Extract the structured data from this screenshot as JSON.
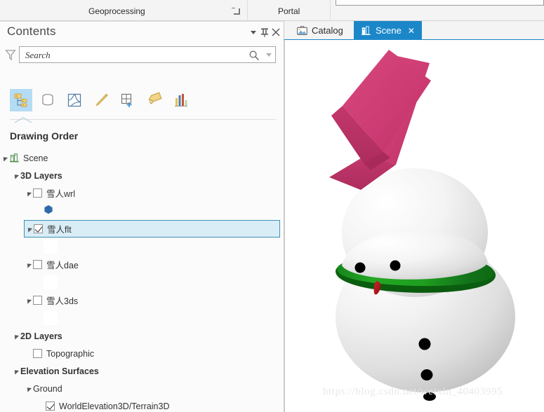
{
  "ribbon": {
    "groups": [
      {
        "label": "Geoprocessing",
        "name": "ribbon-tab-geoprocessing"
      },
      {
        "label": "Portal",
        "name": "ribbon-tab-portal"
      }
    ],
    "launcher_icon": "dialog-launcher-icon"
  },
  "contents": {
    "title": "Contents",
    "header_buttons": [
      {
        "label": "▾",
        "name": "panel-menu-button",
        "icon": "chevron-down-icon"
      },
      {
        "label": "⤓",
        "name": "panel-pin-button",
        "icon": "pin-icon"
      },
      {
        "label": "✕",
        "name": "panel-close-button",
        "icon": "close-icon"
      }
    ],
    "search": {
      "placeholder": "Search",
      "value": "",
      "filter_icon": "filter-funnel-icon",
      "search_icon": "search-icon",
      "dropdown_icon": "chevron-down-icon"
    },
    "toolbar": [
      {
        "name": "list-by-drawing-order-button",
        "icon": "drawing-order-icon",
        "tooltip": "List By Drawing Order",
        "active": true
      },
      {
        "name": "list-by-data-source-button",
        "icon": "database-cylinder-icon",
        "tooltip": "List By Data Source",
        "active": false
      },
      {
        "name": "list-by-selection-button",
        "icon": "selection-polygon-icon",
        "tooltip": "List By Selection",
        "active": false
      },
      {
        "name": "list-by-editing-button",
        "icon": "pencil-icon",
        "tooltip": "List By Editing",
        "active": false
      },
      {
        "name": "list-by-snapping-button",
        "icon": "grid-plus-icon",
        "tooltip": "List By Snapping",
        "active": false
      },
      {
        "name": "list-by-labeling-button",
        "icon": "label-tag-icon",
        "tooltip": "List By Labeling",
        "active": false
      },
      {
        "name": "list-by-charts-button",
        "icon": "bar-chart-icon",
        "tooltip": "List By Charts",
        "active": false
      }
    ],
    "drawing_order_label": "Drawing Order",
    "tree": [
      {
        "label": "Scene",
        "type": "scene",
        "indent": 0,
        "expander": "open",
        "checkbox": "none",
        "icon": "scene-3d-icon",
        "bold": false,
        "selected": false,
        "name": "tree-item-scene"
      },
      {
        "label": "3D Layers",
        "type": "group",
        "indent": 16,
        "expander": "open",
        "checkbox": "none",
        "icon": "",
        "bold": true,
        "selected": false,
        "name": "tree-item-3d-layers"
      },
      {
        "label": "雪人wrl",
        "type": "layer",
        "indent": 34,
        "expander": "open",
        "checkbox": "unchecked",
        "icon": "",
        "bold": false,
        "selected": false,
        "name": "tree-item-snowman-wrl"
      },
      {
        "label": "",
        "type": "swatch-blue",
        "indent": 48,
        "expander": "none",
        "checkbox": "none",
        "icon": "blue-polygon-swatch",
        "bold": false,
        "selected": false,
        "name": "tree-symbol-swatch-wrl"
      },
      {
        "label": "雪人flt",
        "type": "layer",
        "indent": 34,
        "expander": "open",
        "checkbox": "checked",
        "icon": "",
        "bold": false,
        "selected": true,
        "name": "tree-item-snowman-flt"
      },
      {
        "label": "",
        "type": "swatch-blank",
        "indent": 48,
        "expander": "none",
        "checkbox": "none",
        "icon": "blank-swatch",
        "bold": false,
        "selected": false,
        "name": "tree-symbol-swatch-flt"
      },
      {
        "label": "雪人dae",
        "type": "layer",
        "indent": 34,
        "expander": "open",
        "checkbox": "unchecked",
        "icon": "",
        "bold": false,
        "selected": false,
        "name": "tree-item-snowman-dae"
      },
      {
        "label": "",
        "type": "swatch-blank",
        "indent": 48,
        "expander": "none",
        "checkbox": "none",
        "icon": "blank-swatch",
        "bold": false,
        "selected": false,
        "name": "tree-symbol-swatch-dae"
      },
      {
        "label": "雪人3ds",
        "type": "layer",
        "indent": 34,
        "expander": "open",
        "checkbox": "unchecked",
        "icon": "",
        "bold": false,
        "selected": false,
        "name": "tree-item-snowman-3ds"
      },
      {
        "label": "",
        "type": "swatch-blank",
        "indent": 48,
        "expander": "none",
        "checkbox": "none",
        "icon": "blank-swatch",
        "bold": false,
        "selected": false,
        "name": "tree-symbol-swatch-3ds"
      },
      {
        "label": "2D Layers",
        "type": "group",
        "indent": 16,
        "expander": "open",
        "checkbox": "none",
        "icon": "",
        "bold": true,
        "selected": false,
        "name": "tree-item-2d-layers"
      },
      {
        "label": "Topographic",
        "type": "layer",
        "indent": 34,
        "expander": "none",
        "checkbox": "unchecked",
        "icon": "",
        "bold": false,
        "selected": false,
        "name": "tree-item-topographic"
      },
      {
        "label": "Elevation Surfaces",
        "type": "group",
        "indent": 16,
        "expander": "open",
        "checkbox": "none",
        "icon": "",
        "bold": true,
        "selected": false,
        "name": "tree-item-elevation-surfaces"
      },
      {
        "label": "Ground",
        "type": "group",
        "indent": 34,
        "expander": "open",
        "checkbox": "none",
        "icon": "",
        "bold": false,
        "selected": false,
        "name": "tree-item-ground"
      },
      {
        "label": "WorldElevation3D/Terrain3D",
        "type": "layer",
        "indent": 52,
        "expander": "none",
        "checkbox": "checked",
        "icon": "",
        "bold": false,
        "selected": false,
        "name": "tree-item-worldelevation3d-terrain3d"
      }
    ]
  },
  "view": {
    "tabs": [
      {
        "label": "Catalog",
        "name": "tab-catalog",
        "icon": "catalog-icon",
        "active": false,
        "closable": false
      },
      {
        "label": "Scene",
        "name": "tab-scene",
        "icon": "scene-3d-icon",
        "active": true,
        "closable": true,
        "close_label": "✕"
      }
    ],
    "accent_color": "#1b87c9",
    "watermark": "https://blog.csdn.net/weixin_40403995"
  },
  "scene": {
    "name": "3d-snowman-model",
    "background": "#ffffff",
    "colors": {
      "snow_light": "#ffffff",
      "snow_mid": "#e3e3e3",
      "snow_shadow": "#c9c9c9",
      "hat_pink": "#cc3b72",
      "hat_pink_dark": "#b32f62",
      "scarf_green": "#1f9e1f",
      "scarf_green_dark": "#0c6b12",
      "eye_black": "#000000",
      "nose_red": "#b3151a"
    },
    "parts": [
      {
        "name": "snowman-hat",
        "shape": "tilted-box",
        "color": "#cc3b72"
      },
      {
        "name": "snowman-head",
        "shape": "sphere",
        "color": "#ffffff"
      },
      {
        "name": "snowman-eye-left",
        "shape": "dot",
        "color": "#000000"
      },
      {
        "name": "snowman-eye-right",
        "shape": "dot",
        "color": "#000000"
      },
      {
        "name": "snowman-nose",
        "shape": "cone",
        "color": "#b3151a"
      },
      {
        "name": "snowman-scarf",
        "shape": "torus",
        "color": "#1f9e1f"
      },
      {
        "name": "snowman-body",
        "shape": "sphere",
        "color": "#ffffff"
      },
      {
        "name": "snowman-button-1",
        "shape": "dot",
        "color": "#000000"
      },
      {
        "name": "snowman-button-2",
        "shape": "dot",
        "color": "#000000"
      },
      {
        "name": "snowman-button-3",
        "shape": "dot",
        "color": "#000000"
      }
    ]
  }
}
